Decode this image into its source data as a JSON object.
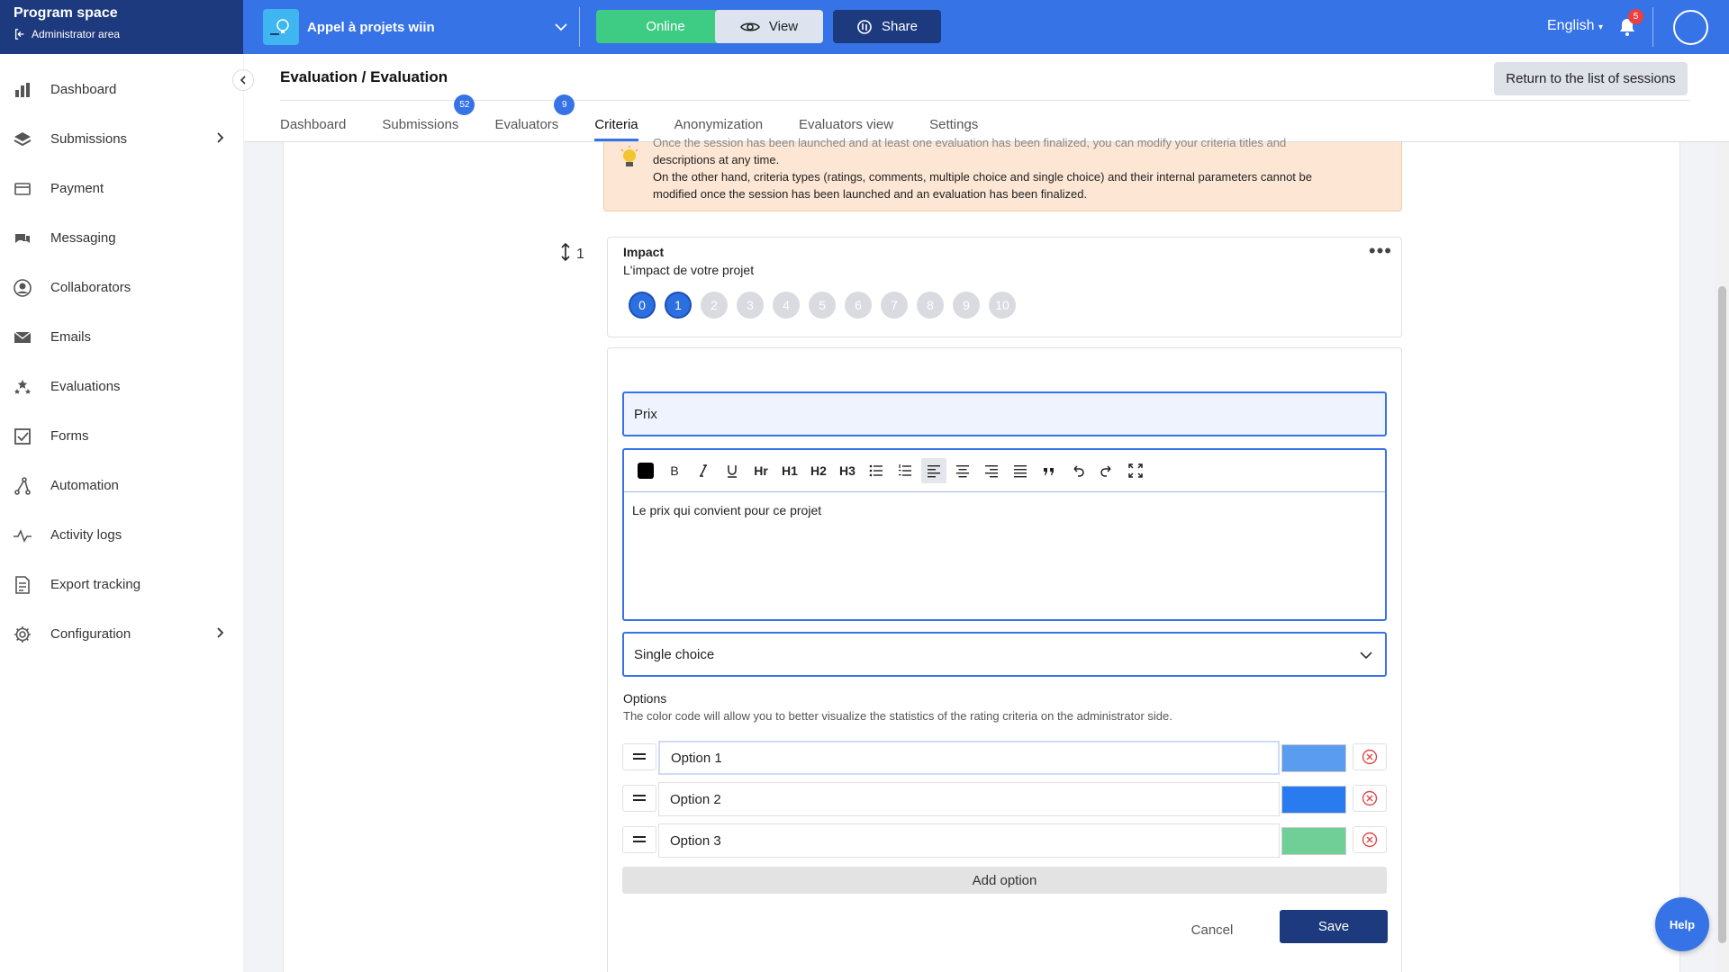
{
  "sidebar": {
    "title": "Program space",
    "subtitle": "Administrator area",
    "items": [
      {
        "label": "Dashboard",
        "icon": "bar-chart-icon"
      },
      {
        "label": "Submissions",
        "icon": "layers-icon",
        "has_submenu": true
      },
      {
        "label": "Payment",
        "icon": "card-icon"
      },
      {
        "label": "Messaging",
        "icon": "chat-icon"
      },
      {
        "label": "Collaborators",
        "icon": "user-circle-icon"
      },
      {
        "label": "Emails",
        "icon": "envelope-icon"
      },
      {
        "label": "Evaluations",
        "icon": "stars-icon"
      },
      {
        "label": "Forms",
        "icon": "checkbox-icon"
      },
      {
        "label": "Automation",
        "icon": "automation-icon"
      },
      {
        "label": "Activity logs",
        "icon": "pulse-icon"
      },
      {
        "label": "Export tracking",
        "icon": "export-doc-icon"
      },
      {
        "label": "Configuration",
        "icon": "gear-icon",
        "has_submenu": true
      }
    ]
  },
  "topbar": {
    "project_name": "Appel à projets wiin",
    "online_label": "Online",
    "view_label": "View",
    "share_label": "Share",
    "language": "English",
    "notification_count": "5"
  },
  "header": {
    "title": "Evaluation / Evaluation",
    "return_label": "Return to the list of sessions",
    "tabs": [
      {
        "label": "Dashboard"
      },
      {
        "label": "Submissions",
        "badge": "52"
      },
      {
        "label": "Evaluators",
        "badge": "9"
      },
      {
        "label": "Criteria",
        "active": true
      },
      {
        "label": "Anonymization"
      },
      {
        "label": "Evaluators view"
      },
      {
        "label": "Settings"
      }
    ]
  },
  "notice": {
    "line1": "Once the session has been launched and at least one evaluation has been finalized, you can modify your criteria titles and",
    "line2": "descriptions at any time.",
    "line3": "On the other hand, criteria types (ratings, comments, multiple choice and single choice) and their internal parameters cannot be",
    "line4": "modified once the session has been launched and an evaluation has been finalized."
  },
  "criterion": {
    "number": "1",
    "title": "Impact",
    "description": "L'impact de votre projet",
    "more": "•••",
    "scale": [
      "0",
      "1",
      "2",
      "3",
      "4",
      "5",
      "6",
      "7",
      "8",
      "9",
      "10"
    ],
    "selected": [
      0,
      1
    ]
  },
  "edit": {
    "title_value": "Prix",
    "toolbar": {
      "bold": "B",
      "hr": "Hr",
      "h1": "H1",
      "h2": "H2",
      "h3": "H3"
    },
    "body_text": "Le prix qui convient pour ce projet",
    "type_value": "Single choice",
    "options_title": "Options",
    "options_help": "The color code will allow you to better visualize the statistics of the rating criteria on the administrator side.",
    "options": [
      {
        "label": "Option 1",
        "color": "#5a9cf0"
      },
      {
        "label": "Option 2",
        "color": "#2a7bef"
      },
      {
        "label": "Option 3",
        "color": "#6fcf97"
      }
    ],
    "add_label": "Add option",
    "cancel_label": "Cancel",
    "save_label": "Save"
  },
  "help_label": "Help",
  "colors": {
    "primary": "#3673e6",
    "navy": "#1d3a7e",
    "online": "#3ecb84",
    "notice_bg": "#fde6d3"
  }
}
